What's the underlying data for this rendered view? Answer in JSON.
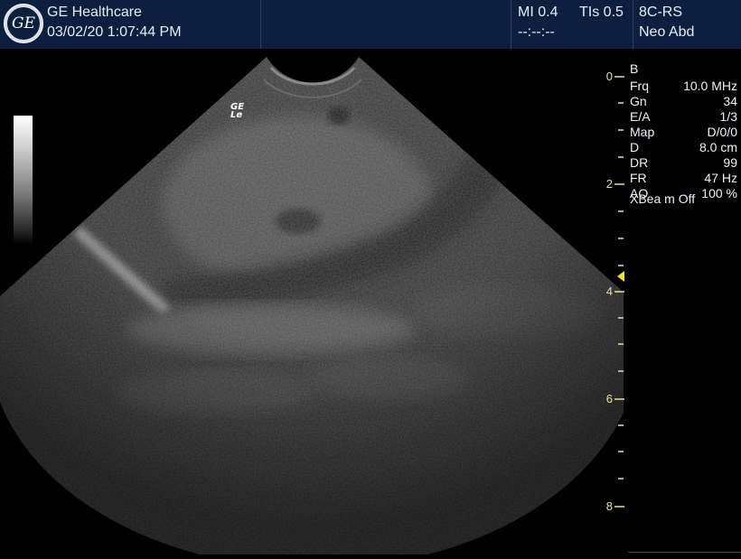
{
  "header": {
    "brand": "GE Healthcare",
    "datetime": "03/02/20 1:07:44 PM",
    "logo_text": "GE",
    "mi": "MI 0.4",
    "tis": "TIs 0.5",
    "timer": "--:--:--",
    "probe": "8C-RS",
    "preset": "Neo Abd"
  },
  "image": {
    "orientation_marker_line1": "GE",
    "orientation_marker_line2": "Le"
  },
  "params": {
    "mode": "B",
    "rows": [
      {
        "key": "Frq",
        "value": "10.0 MHz"
      },
      {
        "key": "Gn",
        "value": "34"
      },
      {
        "key": "E/A",
        "value": "1/3"
      },
      {
        "key": "Map",
        "value": "D/0/0"
      },
      {
        "key": "D",
        "value": "8.0 cm"
      },
      {
        "key": "DR",
        "value": "99"
      },
      {
        "key": "FR",
        "value": "47 Hz"
      },
      {
        "key": "AO",
        "value": "100 %"
      }
    ],
    "xbeam": "XBea m Off"
  },
  "depth_scale": {
    "labels": [
      "0",
      "2",
      "4",
      "6",
      "8"
    ]
  },
  "colors": {
    "header_bg": "#0d1f3f",
    "scale_color": "#e5e2a0",
    "focus_marker": "#f6e23b"
  }
}
